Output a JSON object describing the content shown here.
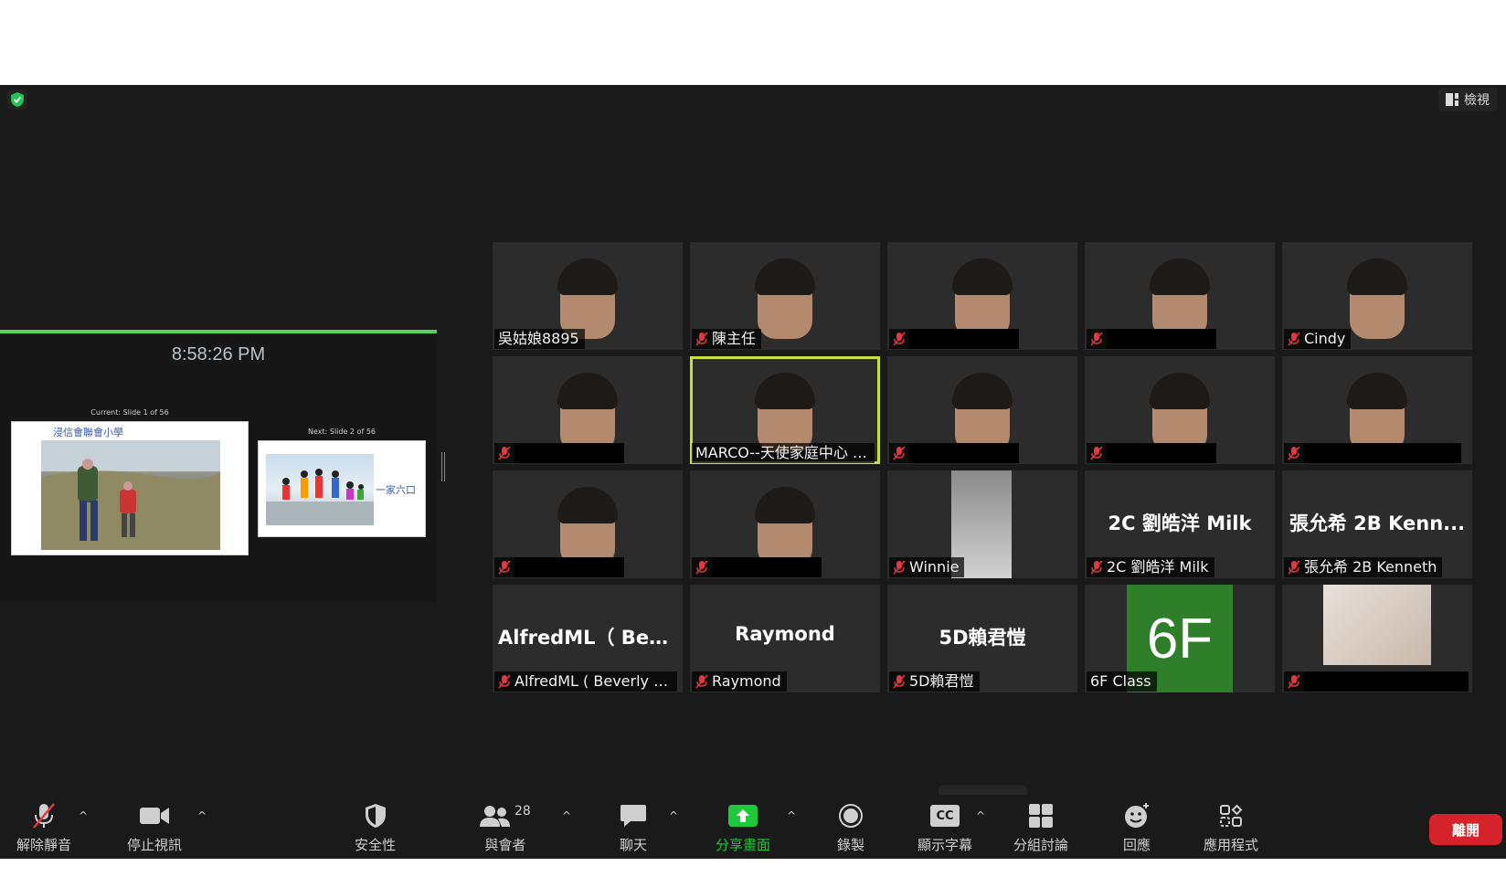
{
  "header": {
    "view_label": "檢視"
  },
  "presenter": {
    "clock": "8:58:26 PM",
    "current_label": "Current: Slide 1 of 56",
    "next_label": "Next: Slide 2 of 56",
    "current_slide_title": "浸信會聯會小學",
    "next_slide_text": "一家六口"
  },
  "gallery": {
    "tiles": [
      {
        "name": "吳姑娘8895",
        "muted": false
      },
      {
        "name": "陳主任",
        "muted": true
      },
      {
        "name": "",
        "muted": true,
        "redacted": true
      },
      {
        "name": "",
        "muted": true,
        "redacted": true
      },
      {
        "name": "Cindy",
        "muted": true
      },
      {
        "name": "",
        "muted": true,
        "redacted": true
      },
      {
        "name": "MARCO--天使家庭中心 (...",
        "muted": false,
        "active": true
      },
      {
        "name": "",
        "muted": true,
        "redacted": true
      },
      {
        "name": "",
        "muted": true,
        "redacted": true
      },
      {
        "name": "",
        "muted": true,
        "redacted": true
      },
      {
        "name": "",
        "muted": true,
        "redacted": true
      },
      {
        "name": "",
        "muted": true,
        "redacted": true
      },
      {
        "name": "Winnie",
        "muted": true
      },
      {
        "name": "2C 劉皓洋 Milk",
        "big": "2C 劉皓洋 Milk",
        "muted": true
      },
      {
        "name": "張允希 2B Kenneth",
        "big": "張允希 2B Kenn...",
        "muted": true
      },
      {
        "name": "AlfredML ( Beverly Cha...",
        "big": "AlfredML（ Beve...",
        "muted": true
      },
      {
        "name": "Raymond",
        "big": "Raymond",
        "muted": true
      },
      {
        "name": "5D賴君愷",
        "big": "5D賴君愷",
        "muted": true
      },
      {
        "name": "6F Class",
        "big": "6F",
        "muted": false
      },
      {
        "name": "",
        "muted": true,
        "redacted": true
      }
    ]
  },
  "toolbar": {
    "unmute": "解除靜音",
    "stop_video": "停止視訊",
    "security": "安全性",
    "participants": "與會者",
    "participants_count": "28",
    "chat": "聊天",
    "share_screen": "分享畫面",
    "record": "錄製",
    "captions": "顯示字幕",
    "captions_icon": "CC",
    "breakout": "分組討論",
    "reactions": "回應",
    "apps": "應用程式",
    "leave": "離開"
  },
  "colors": {
    "share_green": "#1fca3a",
    "leave_red": "#d6222a",
    "active_speaker": "#c9e23a",
    "mic_off_red": "#e0393e"
  }
}
